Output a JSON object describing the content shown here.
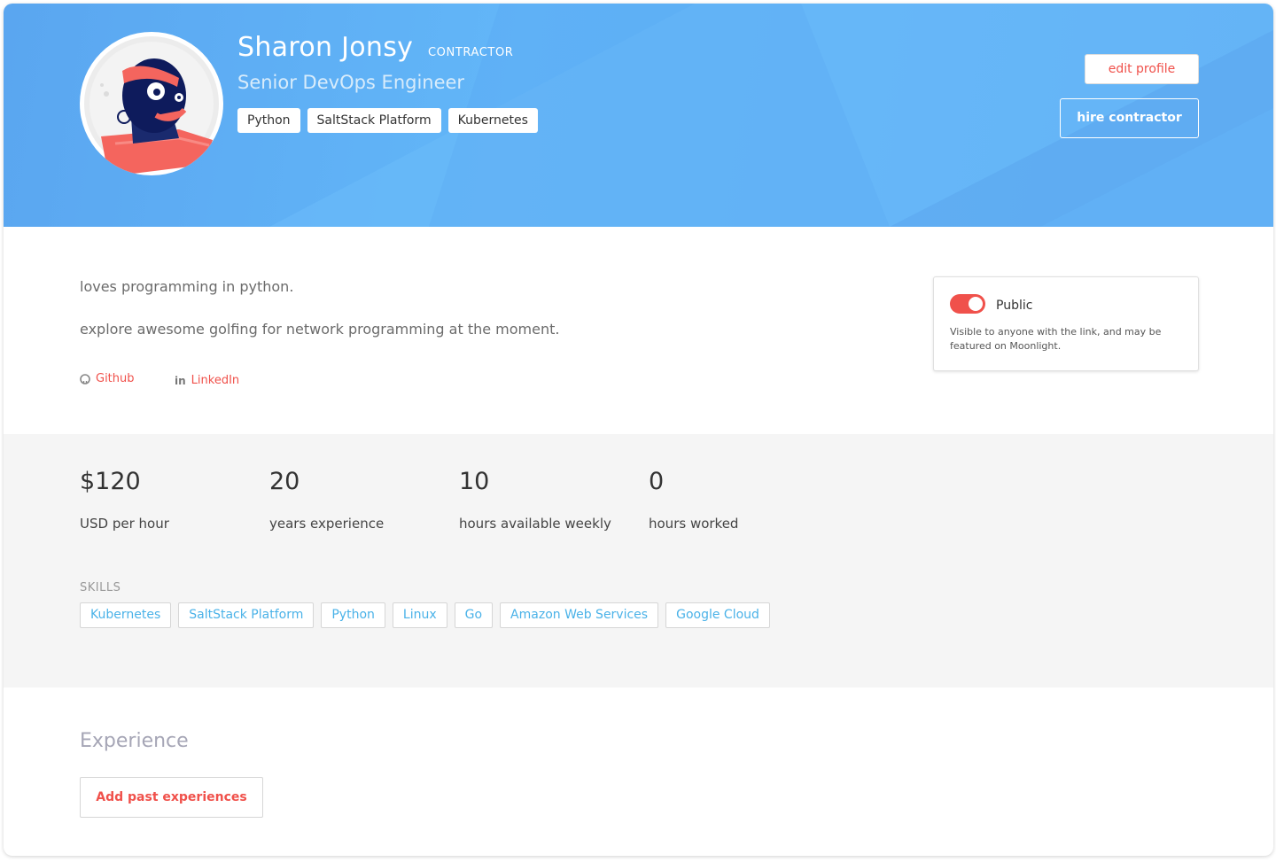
{
  "header": {
    "name": "Sharon Jonsy",
    "role_badge": "CONTRACTOR",
    "job_title": "Senior DevOps Engineer",
    "tags": [
      "Python",
      "SaltStack Platform",
      "Kubernetes"
    ],
    "edit_label": "edit profile",
    "hire_label": "hire contractor"
  },
  "about": {
    "bio": [
      "loves programming in python.",
      "explore awesome golfing for network programming at the moment."
    ],
    "links": {
      "github": {
        "label": "Github",
        "icon": "github-icon"
      },
      "linkedin": {
        "label": "LinkedIn",
        "icon": "linkedin-icon"
      }
    }
  },
  "visibility": {
    "enabled": true,
    "label": "Public",
    "description": "Visible to anyone with the link, and may be featured on Moonlight."
  },
  "stats": [
    {
      "value": "$120",
      "label": "USD per hour"
    },
    {
      "value": "20",
      "label": "years experience"
    },
    {
      "value": "10",
      "label": "hours available weekly"
    },
    {
      "value": "0",
      "label": "hours worked"
    }
  ],
  "skills": {
    "heading": "SKILLS",
    "items": [
      "Kubernetes",
      "SaltStack Platform",
      "Python",
      "Linux",
      "Go",
      "Amazon Web Services",
      "Google Cloud"
    ]
  },
  "experience": {
    "title": "Experience",
    "add_label": "Add past experiences"
  },
  "colors": {
    "accent": "#f0514b",
    "header_blue": "#5cabf2",
    "skill_text": "#4ab2e8"
  }
}
